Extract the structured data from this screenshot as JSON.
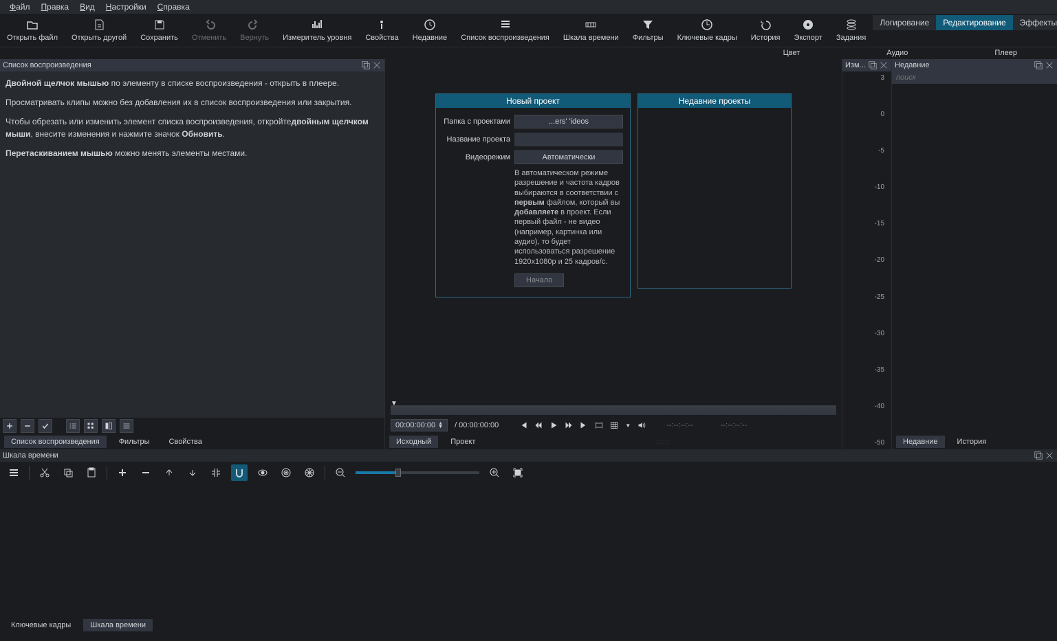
{
  "menubar": [
    "Файл",
    "Правка",
    "Вид",
    "Настройки",
    "Справка"
  ],
  "toolbar": [
    {
      "id": "open-file",
      "label": "Открыть файл"
    },
    {
      "id": "open-other",
      "label": "Открыть другой"
    },
    {
      "id": "save",
      "label": "Сохранить"
    },
    {
      "id": "undo",
      "label": "Отменить",
      "dim": true
    },
    {
      "id": "redo",
      "label": "Вернуть",
      "dim": true
    },
    {
      "id": "level-meter",
      "label": "Измеритель уровня"
    },
    {
      "id": "properties",
      "label": "Свойства"
    },
    {
      "id": "recent",
      "label": "Недавние"
    },
    {
      "id": "playlist",
      "label": "Список воспроизведения"
    },
    {
      "id": "timeline",
      "label": "Шкала времени"
    },
    {
      "id": "filters",
      "label": "Фильтры"
    },
    {
      "id": "keyframes",
      "label": "Ключевые кадры"
    },
    {
      "id": "history",
      "label": "История"
    },
    {
      "id": "export",
      "label": "Экспорт"
    },
    {
      "id": "jobs",
      "label": "Задания"
    }
  ],
  "mode_tabs": [
    {
      "id": "logging",
      "label": "Логирование"
    },
    {
      "id": "editing",
      "label": "Редактирование",
      "active": true
    },
    {
      "id": "effects",
      "label": "Эффекты"
    }
  ],
  "second_row": [
    {
      "id": "color",
      "label": "Цвет"
    },
    {
      "id": "audio",
      "label": "Аудио"
    },
    {
      "id": "player",
      "label": "Плеер"
    }
  ],
  "panels": {
    "playlist_title": "Список воспроизведения",
    "meter_title": "Изм...",
    "recent_title": "Недавние",
    "timeline_title": "Шкала времени"
  },
  "help": {
    "p1b": "Двойной щелчок мышью",
    "p1": " по элементу в списке воспроизведения - открыть в плеере.",
    "p2": "Просматривать клипы можно без добавления их в список воспроизведения или закрытия.",
    "p3a": "Чтобы обрезать или изменить элемент списка воспроизведения, откройте",
    "p3b": "двойным щелчком мыши",
    "p3c": ", внесите изменения и нажмите значок ",
    "p3d": "Обновить",
    "p3e": ".",
    "p4a": "Перетаскиванием мышью",
    "p4b": " можно менять элементы местами."
  },
  "new_project": {
    "title": "Новый проект",
    "folder_label": "Папка с проектами",
    "folder_value": "...ers'                       'ideos",
    "name_label": "Название проекта",
    "name_value": "",
    "mode_label": "Видеорежим",
    "mode_value": "Автоматически",
    "desc_a": "В автоматическом режиме разрешение и частота кадров выбираются в соответствии с ",
    "desc_b": "первым",
    "desc_c": " файлом, который вы ",
    "desc_d": "добавляете",
    "desc_e": " в проект. Если первый файл - не видео (например, картинка или аудио), то будет использоваться разрешение 1920x1080p и 25 кадров/с.",
    "start": "Начало"
  },
  "recent_projects": {
    "title": "Недавние проекты"
  },
  "transport": {
    "tc": "00:00:00:00",
    "dur": "/ 00:00:00:00",
    "in_out": "--:--:--:--",
    "in_out2": "--:--:--:--"
  },
  "db_ticks": [
    "3",
    "0",
    "-5",
    "-10",
    "-15",
    "-20",
    "-25",
    "-30",
    "-35",
    "-40",
    "-50"
  ],
  "left_tabs": [
    {
      "id": "playlist",
      "label": "Список воспроизведения",
      "active": true
    },
    {
      "id": "filters",
      "label": "Фильтры"
    },
    {
      "id": "properties",
      "label": "Свойства"
    }
  ],
  "center_tabs": [
    {
      "id": "source",
      "label": "Исходный",
      "active": true
    },
    {
      "id": "project",
      "label": "Проект"
    }
  ],
  "right_tabs": [
    {
      "id": "recent",
      "label": "Недавние",
      "active": true
    },
    {
      "id": "history",
      "label": "История"
    }
  ],
  "footer_tabs": [
    {
      "id": "keyframes",
      "label": "Ключевые кадры"
    },
    {
      "id": "timeline",
      "label": "Шкала времени",
      "active": true
    }
  ],
  "search_placeholder": "поиск"
}
